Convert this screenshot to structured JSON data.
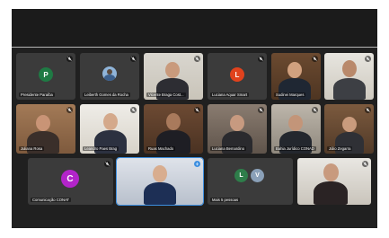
{
  "participants": [
    {
      "name": "Presidente Paraíba",
      "type": "avatar",
      "initial": "P",
      "avatar_color": "#1f7a44"
    },
    {
      "name": "Leiberth Gomes da Rocha",
      "type": "photo-avatar",
      "avatar_color": "#8fb4d9"
    },
    {
      "name": "Vicente Braga Cost...",
      "type": "video"
    },
    {
      "name": "Luciana Aquar Smart",
      "type": "avatar",
      "initial": "L",
      "avatar_color": "#e0421d"
    },
    {
      "name": "Sudinei Marques",
      "type": "video"
    },
    {
      "name": "",
      "type": "video"
    },
    {
      "name": "Juliana Rosa",
      "type": "video"
    },
    {
      "name": "Leandro Paes Brag",
      "type": "video"
    },
    {
      "name": "Ruas Machado",
      "type": "video"
    },
    {
      "name": "Luciana Bemardino",
      "type": "video"
    },
    {
      "name": "Bahia Jurídico CONAD",
      "type": "video"
    },
    {
      "name": "Júlio Zegarra",
      "type": "video"
    },
    {
      "name": "Comunicação CONAT",
      "type": "avatar",
      "initial": "C",
      "avatar_color": "#b224c9"
    },
    {
      "name": "",
      "type": "video"
    },
    {
      "name": "Mais 5 pessoas",
      "type": "group",
      "initials": [
        "L",
        "V"
      ],
      "avatar_colors": [
        "#2e7d4a",
        "#8aa0b8"
      ]
    },
    {
      "name": "",
      "type": "video"
    }
  ],
  "colors": {
    "background": "#1b1b1b",
    "tile": "#3a3a3a",
    "active_outline": "#3d8fe0"
  }
}
